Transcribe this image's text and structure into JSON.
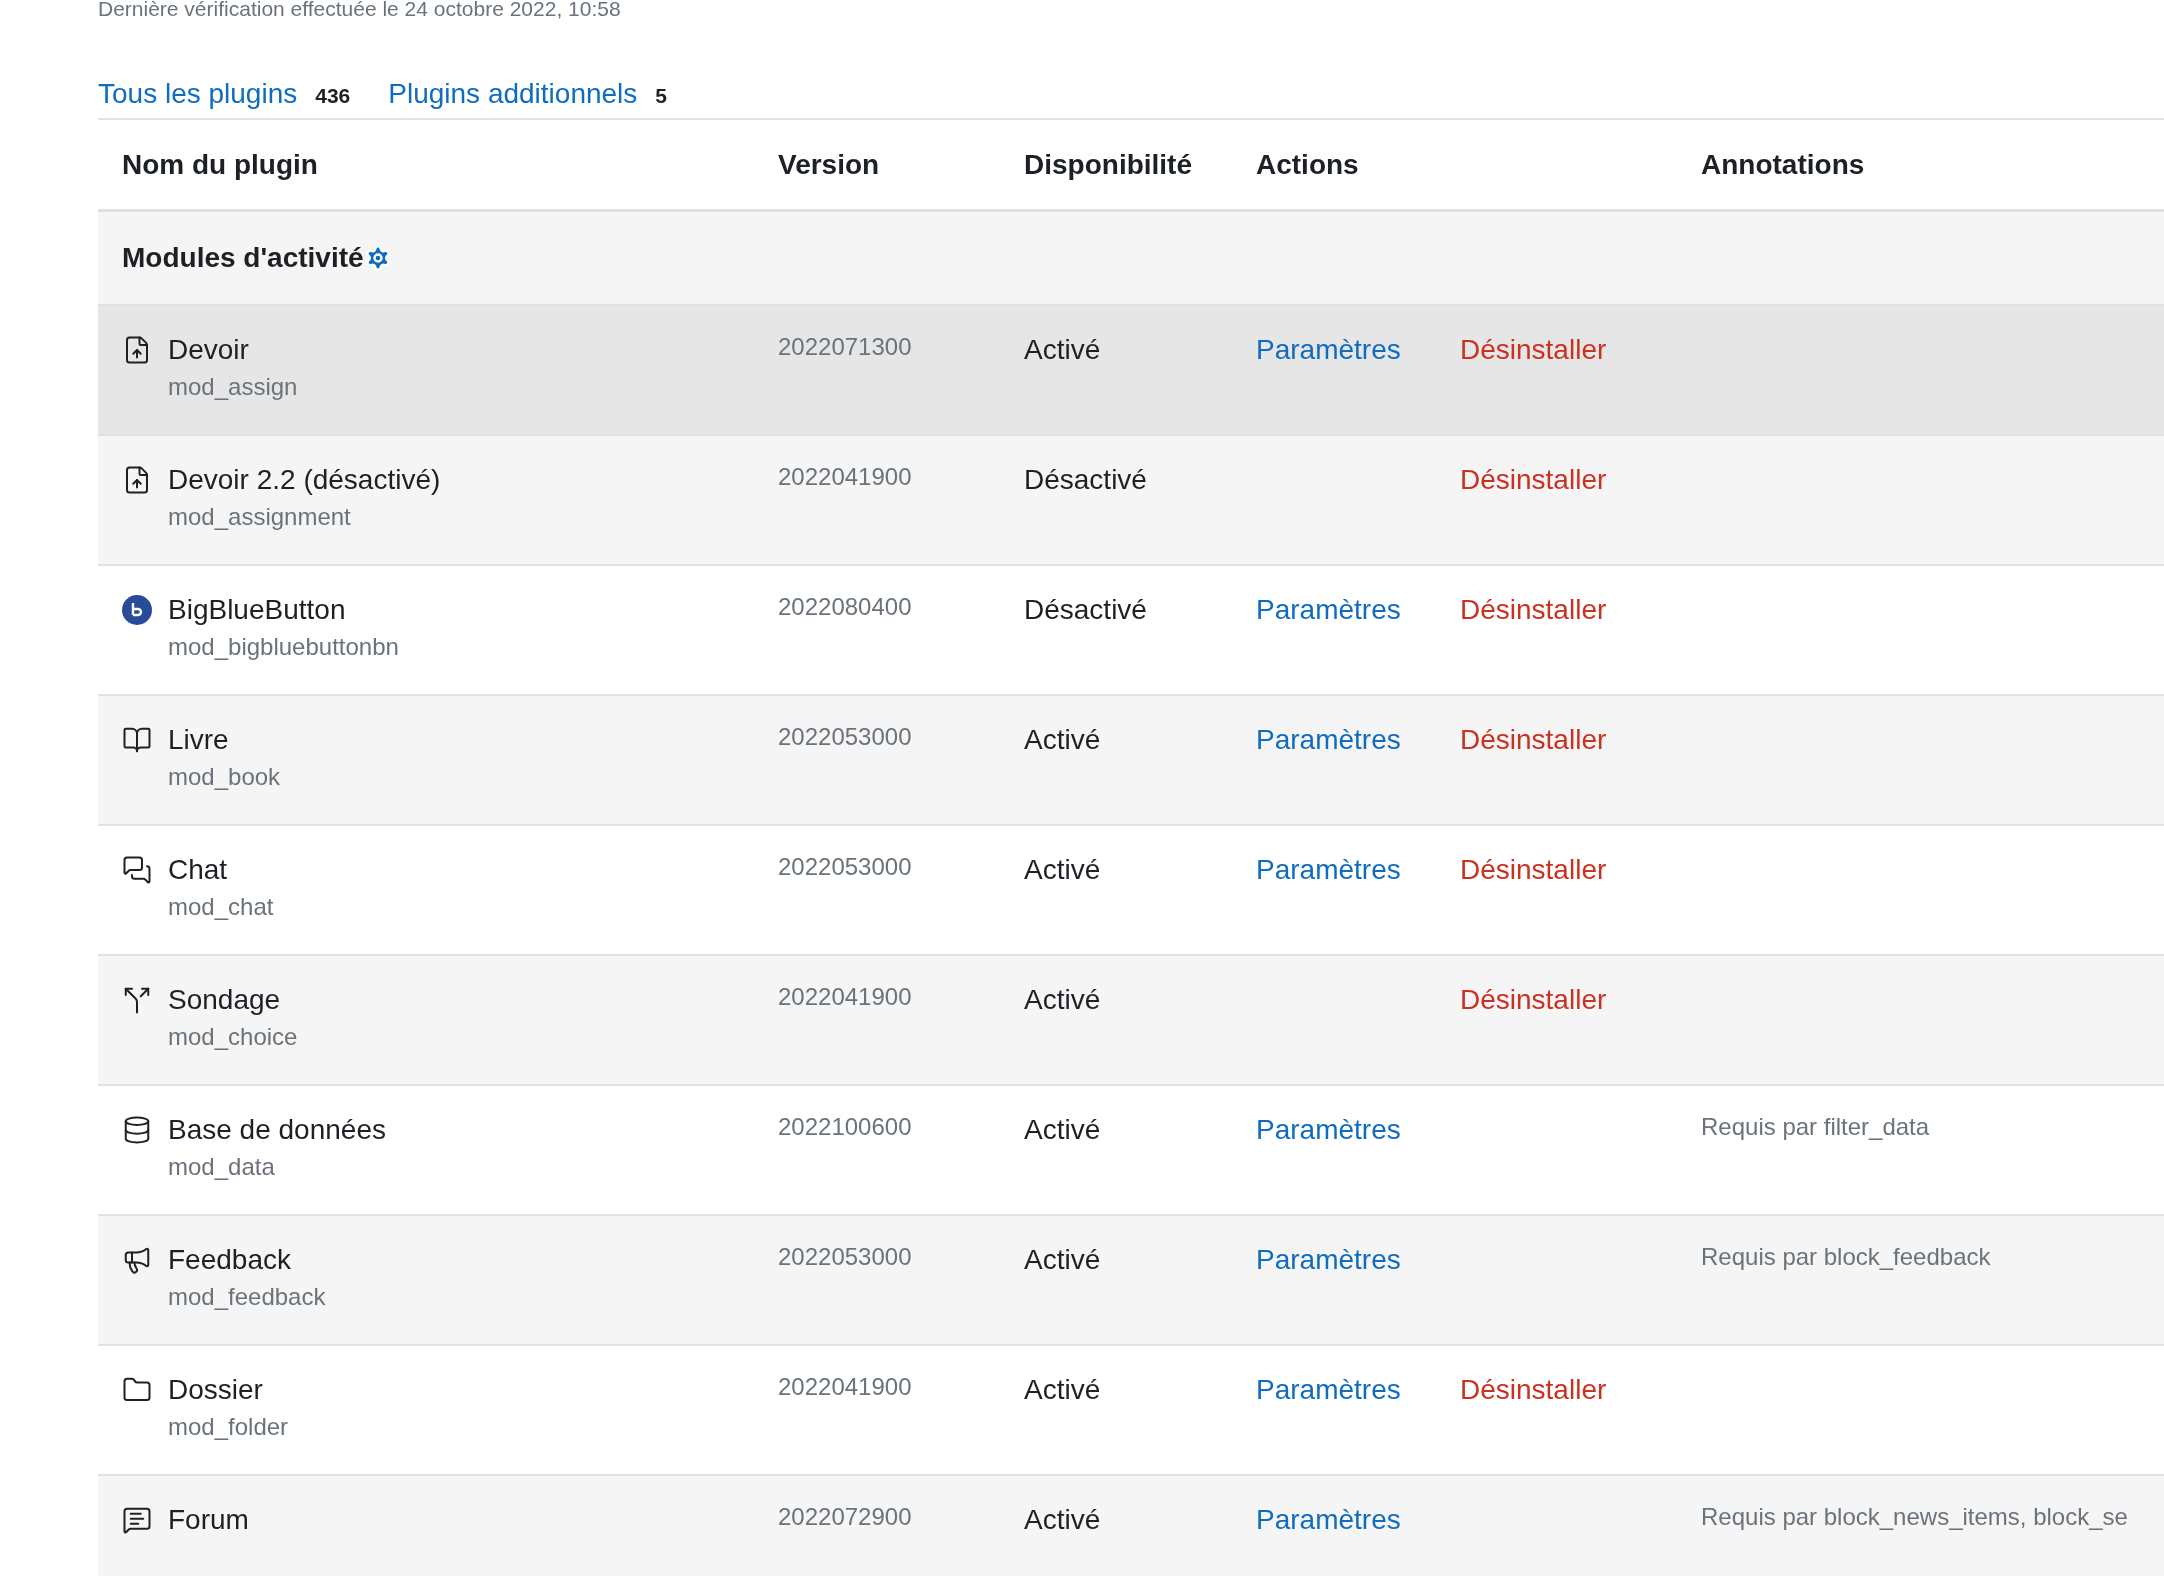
{
  "last_check": "Dernière vérification effectuée le 24 octobre 2022, 10:58",
  "tabs": [
    {
      "label": "Tous les plugins",
      "count": "436"
    },
    {
      "label": "Plugins additionnels",
      "count": "5"
    }
  ],
  "table": {
    "columns": [
      "Nom du plugin",
      "Version",
      "Disponibilité",
      "Actions",
      "Annotations"
    ],
    "group": {
      "title": "Modules d'activité"
    },
    "rows": [
      {
        "kind": "file-up",
        "name": "Devoir",
        "component": "mod_assign",
        "version": "2022071300",
        "availability": "Activé",
        "settings": "Paramètres",
        "uninstall": "Désinstaller",
        "highlighted": true
      },
      {
        "kind": "file-up",
        "name": "Devoir 2.2 (désactivé)",
        "component": "mod_assignment",
        "version": "2022041900",
        "availability": "Désactivé",
        "uninstall": "Désinstaller",
        "highlighted": false
      },
      {
        "kind": "bbb",
        "name": "BigBlueButton",
        "component": "mod_bigbluebuttonbn",
        "version": "2022080400",
        "availability": "Désactivé",
        "settings": "Paramètres",
        "uninstall": "Désinstaller",
        "highlighted": false
      },
      {
        "kind": "book",
        "name": "Livre",
        "component": "mod_book",
        "version": "2022053000",
        "availability": "Activé",
        "settings": "Paramètres",
        "uninstall": "Désinstaller",
        "highlighted": false
      },
      {
        "kind": "chat",
        "name": "Chat",
        "component": "mod_chat",
        "version": "2022053000",
        "availability": "Activé",
        "settings": "Paramètres",
        "uninstall": "Désinstaller",
        "highlighted": false
      },
      {
        "kind": "choice",
        "name": "Sondage",
        "component": "mod_choice",
        "version": "2022041900",
        "availability": "Activé",
        "uninstall": "Désinstaller",
        "highlighted": false
      },
      {
        "kind": "database",
        "name": "Base de données",
        "component": "mod_data",
        "version": "2022100600",
        "availability": "Activé",
        "settings": "Paramètres",
        "annotation": "Requis par filter_data",
        "highlighted": false
      },
      {
        "kind": "megaphone",
        "name": "Feedback",
        "component": "mod_feedback",
        "version": "2022053000",
        "availability": "Activé",
        "settings": "Paramètres",
        "annotation": "Requis par block_feedback",
        "highlighted": false
      },
      {
        "kind": "folder",
        "name": "Dossier",
        "component": "mod_folder",
        "version": "2022041900",
        "availability": "Activé",
        "settings": "Paramètres",
        "uninstall": "Désinstaller",
        "highlighted": false
      },
      {
        "kind": "forum",
        "name": "Forum",
        "version": "2022072900",
        "availability": "Activé",
        "settings": "Paramètres",
        "annotation": "Requis par block_news_items, block_se",
        "highlighted": false
      }
    ]
  }
}
